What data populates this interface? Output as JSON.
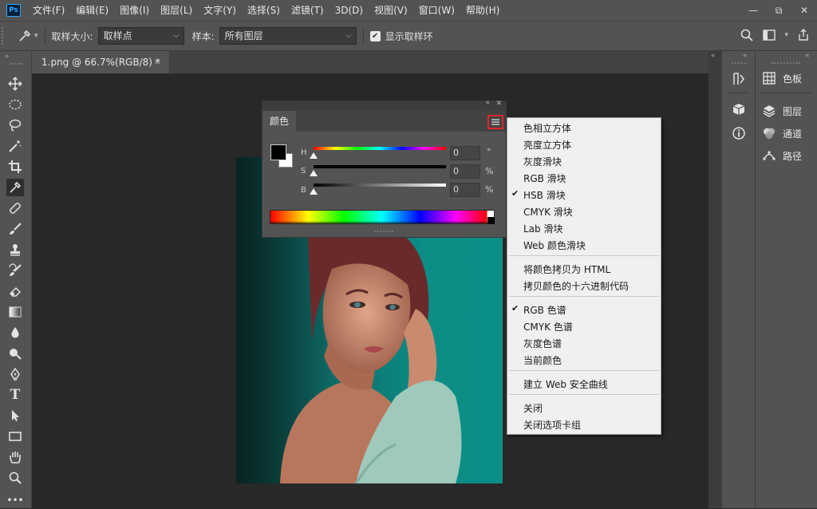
{
  "app": {
    "logo": "Ps"
  },
  "menubar": {
    "items": [
      "文件(F)",
      "编辑(E)",
      "图像(I)",
      "图层(L)",
      "文字(Y)",
      "选择(S)",
      "滤镜(T)",
      "3D(D)",
      "视图(V)",
      "窗口(W)",
      "帮助(H)"
    ],
    "win_min": "—",
    "win_restore": "⧉",
    "win_close": "✕"
  },
  "options": {
    "sample_size_label": "取样大小:",
    "sample_size_value": "取样点",
    "sample_label": "样本:",
    "sample_value": "所有图层",
    "show_ring_label": "显示取样环",
    "show_ring_checked": true
  },
  "document": {
    "tab_title": "1.png @ 66.7%(RGB/8) *",
    "close": "×"
  },
  "right_panels": {
    "swatches": "色板",
    "layers": "图层",
    "channels": "通道",
    "paths": "路径"
  },
  "color_panel": {
    "tab": "颜色",
    "sliders": [
      {
        "label": "H",
        "value": "0",
        "unit": "°"
      },
      {
        "label": "S",
        "value": "0",
        "unit": "%"
      },
      {
        "label": "B",
        "value": "0",
        "unit": "%"
      }
    ],
    "foreground": "#000000",
    "background": "#ffffff"
  },
  "context_menu": {
    "items": [
      {
        "label": "色相立方体",
        "checked": false
      },
      {
        "label": "亮度立方体",
        "checked": false
      },
      {
        "label": "灰度滑块",
        "checked": false
      },
      {
        "label": "RGB 滑块",
        "checked": false
      },
      {
        "label": "HSB 滑块",
        "checked": true
      },
      {
        "label": "CMYK 滑块",
        "checked": false
      },
      {
        "label": "Lab 滑块",
        "checked": false
      },
      {
        "label": "Web 颜色滑块",
        "checked": false
      },
      {
        "label": "将颜色拷贝为 HTML",
        "checked": false
      },
      {
        "label": "拷贝颜色的十六进制代码",
        "checked": false
      },
      {
        "label": "RGB 色谱",
        "checked": true
      },
      {
        "label": "CMYK 色谱",
        "checked": false
      },
      {
        "label": "灰度色谱",
        "checked": false
      },
      {
        "label": "当前颜色",
        "checked": false
      },
      {
        "label": "建立 Web 安全曲线",
        "checked": false
      },
      {
        "label": "关闭",
        "checked": false
      },
      {
        "label": "关闭选项卡组",
        "checked": false
      }
    ],
    "check_glyph": "✔"
  },
  "colors": {
    "highlight_border": "#e0262a",
    "ui_bg": "#535353",
    "canvas_bg": "#282828",
    "photo_teal": "#0c8d86"
  }
}
